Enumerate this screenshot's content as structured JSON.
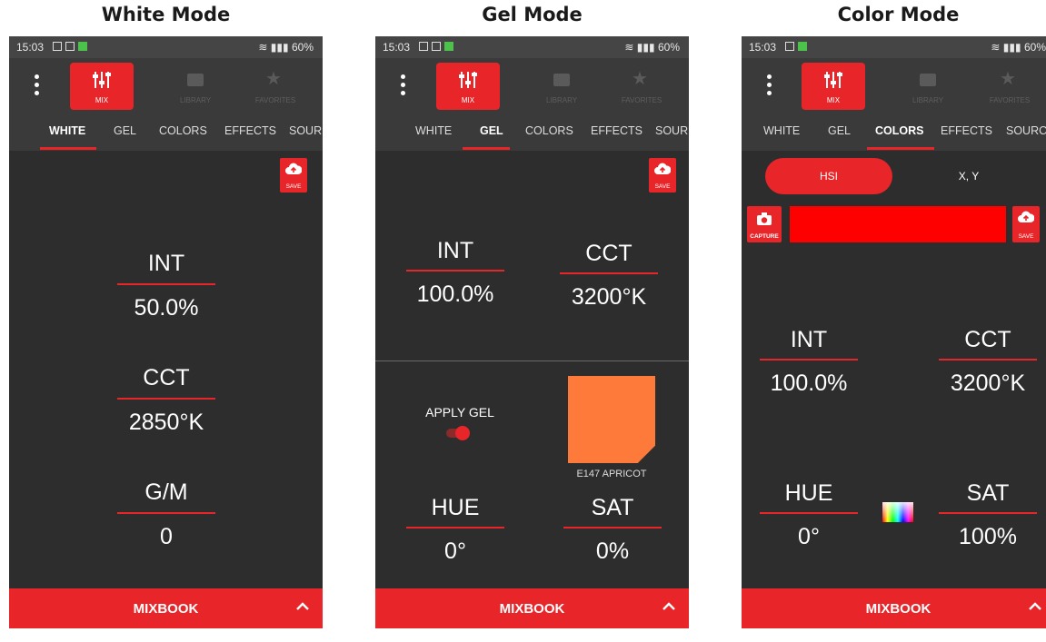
{
  "colors": {
    "accent": "#e8262a",
    "background": "#2d2d2d",
    "bar": "#3a3a3a",
    "gel_swatch": "#fd7a3a",
    "color_preview": "#ff0000"
  },
  "panels": [
    {
      "mode_title": "White Mode",
      "status": {
        "time": "15:03",
        "right": "60%"
      },
      "nav": {
        "mix": "MIX",
        "library": "LIBRARY",
        "favorites": "FAVORITES"
      },
      "tabs": [
        "WHITE",
        "GEL",
        "COLORS",
        "EFFECTS",
        "SOUR"
      ],
      "active_tab": "WHITE",
      "save_label": "SAVE",
      "values": [
        {
          "label": "INT",
          "value": "50.0%"
        },
        {
          "label": "CCT",
          "value": "2850°K"
        },
        {
          "label": "G/M",
          "value": "0"
        }
      ],
      "mixbook": "MIXBOOK"
    },
    {
      "mode_title": "Gel Mode",
      "status": {
        "time": "15:03",
        "right": "60%"
      },
      "nav": {
        "mix": "MIX",
        "library": "LIBRARY",
        "favorites": "FAVORITES"
      },
      "tabs": [
        "WHITE",
        "GEL",
        "COLORS",
        "EFFECTS",
        "SOUR"
      ],
      "active_tab": "GEL",
      "save_label": "SAVE",
      "values": [
        {
          "label": "INT",
          "value": "100.0%"
        },
        {
          "label": "CCT",
          "value": "3200°K"
        },
        {
          "label": "HUE",
          "value": "0°"
        },
        {
          "label": "SAT",
          "value": "0%"
        }
      ],
      "apply_gel_label": "APPLY GEL",
      "apply_gel_on": true,
      "gel_name": "E147 APRICOT",
      "mixbook": "MIXBOOK"
    },
    {
      "mode_title": "Color Mode",
      "status": {
        "time": "15:03",
        "right": "60%"
      },
      "nav": {
        "mix": "MIX",
        "library": "LIBRARY",
        "favorites": "FAVORITES"
      },
      "tabs": [
        "WHITE",
        "GEL",
        "COLORS",
        "EFFECTS",
        "SOURC"
      ],
      "active_tab": "COLORS",
      "segments": [
        "HSI",
        "X, Y"
      ],
      "active_segment": "HSI",
      "capture_label": "CAPTURE",
      "save_label": "SAVE",
      "values": [
        {
          "label": "INT",
          "value": "100.0%"
        },
        {
          "label": "CCT",
          "value": "3200°K"
        },
        {
          "label": "HUE",
          "value": "0°"
        },
        {
          "label": "SAT",
          "value": "100%"
        }
      ],
      "mixbook": "MIXBOOK"
    }
  ]
}
